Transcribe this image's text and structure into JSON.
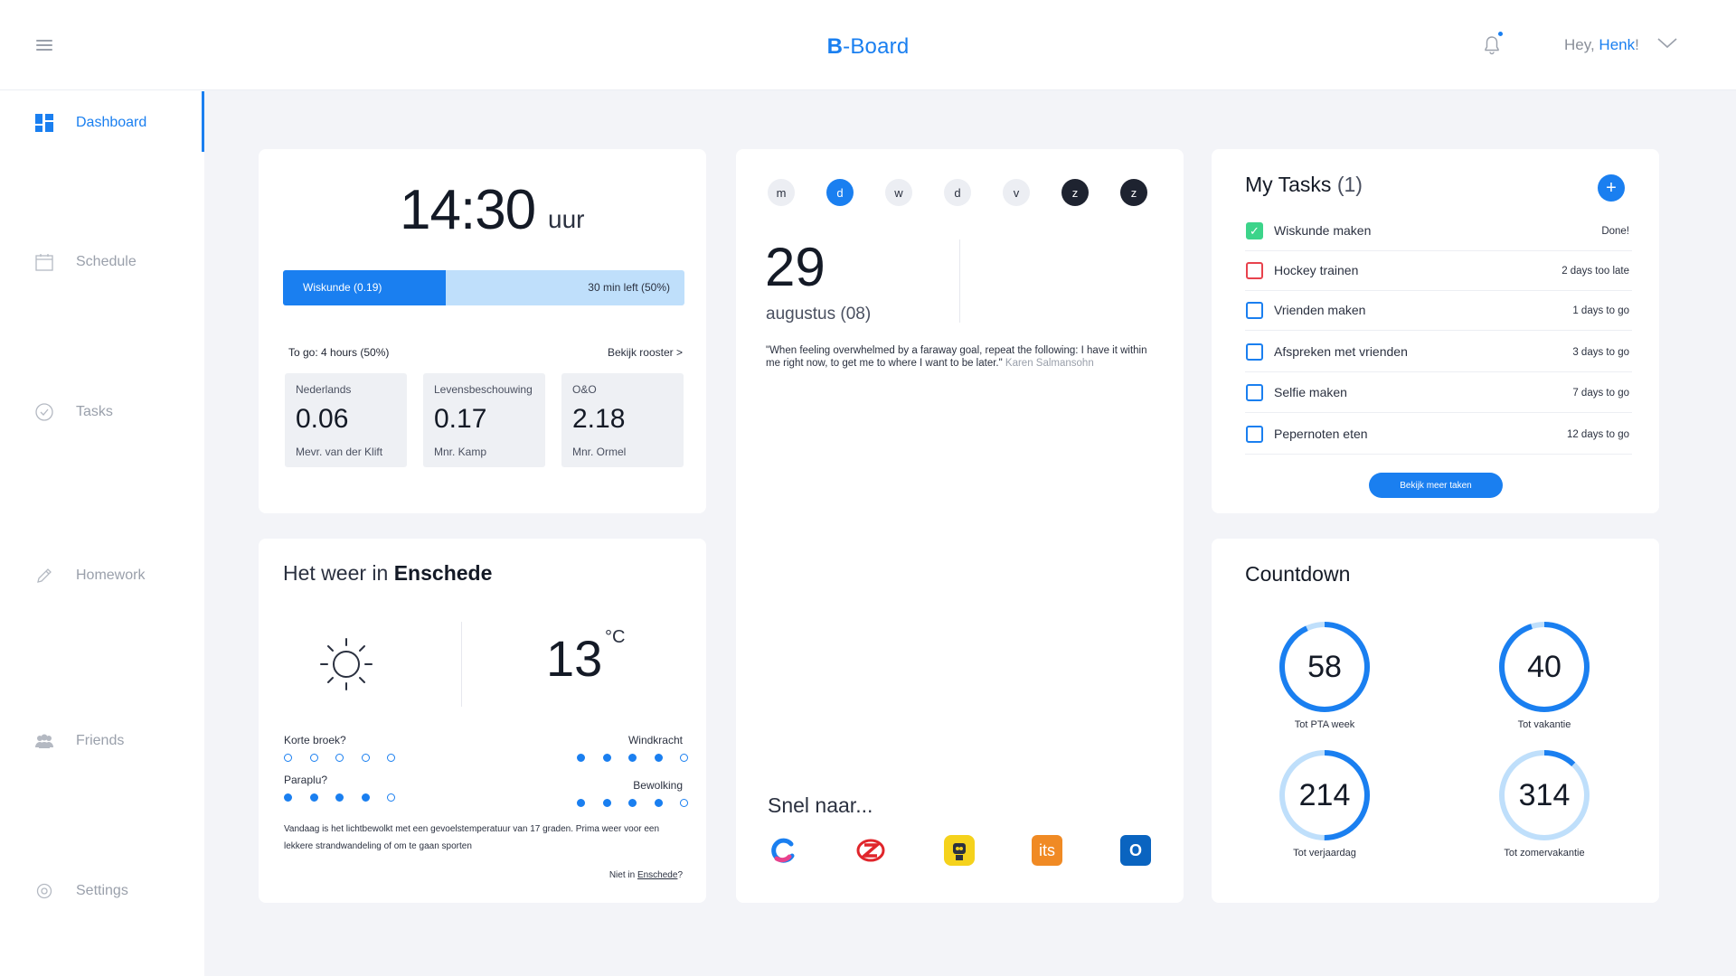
{
  "header": {
    "brand_prefix": "B",
    "brand_suffix": "-Board",
    "greeting": "Hey, ",
    "user_name": "Henk",
    "greeting_suffix": "!"
  },
  "sidebar": {
    "items": [
      {
        "label": "Dashboard",
        "icon": "grid-icon",
        "active": true
      },
      {
        "label": "Schedule",
        "icon": "calendar-icon",
        "active": false
      },
      {
        "label": "Tasks",
        "icon": "check-circle-icon",
        "active": false
      },
      {
        "label": "Homework",
        "icon": "pencil-icon",
        "active": false
      },
      {
        "label": "Friends",
        "icon": "people-icon",
        "active": false
      },
      {
        "label": "Settings",
        "icon": "gear-icon",
        "active": false
      }
    ]
  },
  "clock": {
    "time": "14:30",
    "unit": "uur",
    "progress_label": "Wiskunde (0.19)",
    "progress_right": "30 min left (50%)",
    "progress_fraction": 0.406,
    "to_go": "To go: 4 hours (50%)",
    "rooster_link": "Bekijk rooster >",
    "subjects": [
      {
        "name": "Nederlands",
        "room": "0.06",
        "teacher": "Mevr. van der Klift"
      },
      {
        "name": "Levensbeschouwing",
        "room": "0.17",
        "teacher": "Mnr. Kamp"
      },
      {
        "name": "O&O",
        "room": "2.18",
        "teacher": "Mnr. Ormel"
      }
    ]
  },
  "calendar": {
    "days": [
      {
        "label": "m",
        "state": "normal"
      },
      {
        "label": "d",
        "state": "selected"
      },
      {
        "label": "w",
        "state": "normal"
      },
      {
        "label": "d",
        "state": "normal"
      },
      {
        "label": "v",
        "state": "normal"
      },
      {
        "label": "z",
        "state": "dark"
      },
      {
        "label": "z",
        "state": "dark"
      }
    ],
    "day_number": "29",
    "month": "augustus (08)",
    "quote": "\"When feeling overwhelmed by a faraway goal, repeat the following: I have it within me right now, to get me to where I want to be later.\"",
    "quote_author": "Karen Salmansohn",
    "snel_title": "Snel naar...",
    "apps": [
      "c-app-icon",
      "z-app-icon",
      "robot-app-icon",
      "its-app-icon",
      "outlook-app-icon"
    ],
    "its_label": "its",
    "outlook_label": "O"
  },
  "tasks": {
    "title": "My Tasks",
    "count": "(1)",
    "add_label": "+",
    "items": [
      {
        "name": "Wiskunde maken",
        "due": "Done!",
        "state": "done"
      },
      {
        "name": "Hockey trainen",
        "due": "2 days too late",
        "state": "late"
      },
      {
        "name": "Vrienden maken",
        "due": "1 days to go",
        "state": "open"
      },
      {
        "name": "Afspreken met vrienden",
        "due": "3 days to go",
        "state": "open"
      },
      {
        "name": "Selfie maken",
        "due": "7 days to go",
        "state": "open"
      },
      {
        "name": "Pepernoten eten",
        "due": "12 days to go",
        "state": "open"
      }
    ],
    "more_button": "Bekijk meer taken"
  },
  "weather": {
    "title_prefix": "Het weer in ",
    "city": "Enschede",
    "temperature": "13",
    "unit": "°C",
    "icon": "sun-icon",
    "indicators": [
      {
        "label": "Korte broek?",
        "filled": 0,
        "total": 5
      },
      {
        "label": "Windkracht",
        "filled": 4,
        "total": 5
      },
      {
        "label": "Paraplu?",
        "filled": 4,
        "total": 5
      },
      {
        "label": "Bewolking",
        "filled": 4,
        "total": 5
      }
    ],
    "description": "Vandaag is het lichtbewolkt met een gevoelstemperatuur van 17 graden. Prima weer voor een lekkere strandwandeling of om te gaan sporten",
    "not_in_prefix": "Niet in ",
    "not_in_city": "Enschede",
    "not_in_suffix": "?"
  },
  "countdown": {
    "title": "Countdown",
    "items": [
      {
        "value": "58",
        "label": "Tot PTA week",
        "fraction": 0.93
      },
      {
        "value": "40",
        "label": "Tot vakantie",
        "fraction": 0.95
      },
      {
        "value": "214",
        "label": "Tot verjaardag",
        "fraction": 0.5
      },
      {
        "value": "314",
        "label": "Tot zomervakantie",
        "fraction": 0.12
      }
    ]
  },
  "colors": {
    "accent": "#1a7ff0",
    "accent_light": "#bfdffb",
    "dark": "#1e2330",
    "success": "#3cd48a",
    "danger": "#e8424d"
  }
}
